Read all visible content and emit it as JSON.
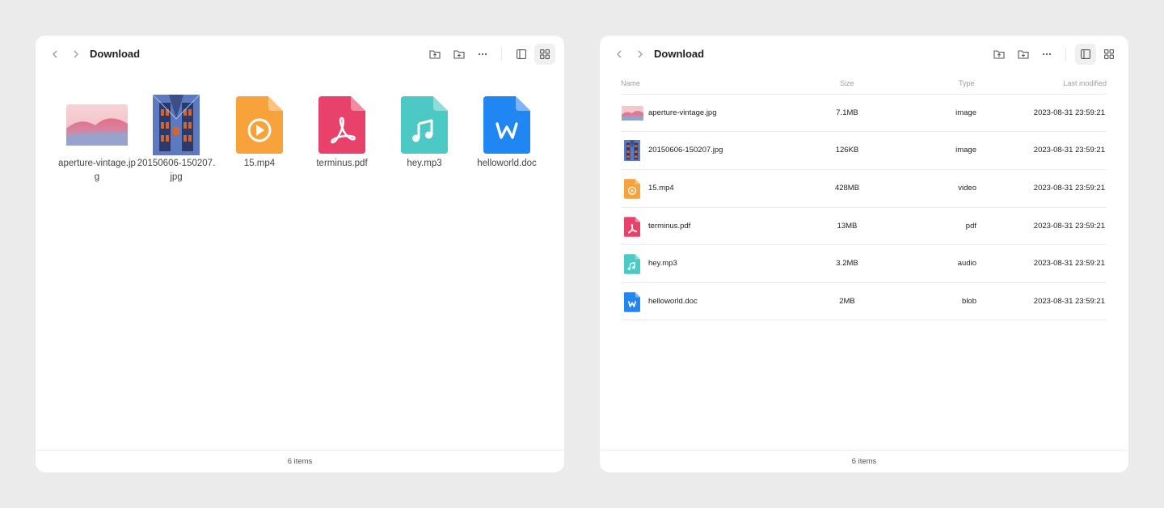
{
  "windows": [
    {
      "view": "grid",
      "title": "Download",
      "footer": "6 items",
      "items": [
        {
          "name": "aperture-vintage.jpg",
          "icon": "landscape-thumbnail"
        },
        {
          "name": "20150606-150207.jpg",
          "icon": "building-thumbnail"
        },
        {
          "name": "15.mp4",
          "icon": "video-file-icon",
          "color": "#f7a23b"
        },
        {
          "name": "terminus.pdf",
          "icon": "pdf-file-icon",
          "color": "#e8426a"
        },
        {
          "name": "hey.mp3",
          "icon": "audio-file-icon",
          "color": "#4cc9c4"
        },
        {
          "name": "helloworld.doc",
          "icon": "word-file-icon",
          "color": "#1f86f2"
        }
      ]
    },
    {
      "view": "list",
      "title": "Download",
      "footer": "6 items",
      "columns": {
        "name": "Name",
        "size": "Size",
        "type": "Type",
        "modified": "Last modified"
      },
      "rows": [
        {
          "name": "aperture-vintage.jpg",
          "size": "7.1MB",
          "type": "image",
          "modified": "2023-08-31 23:59:21",
          "icon": "landscape-thumbnail"
        },
        {
          "name": "20150606-150207.jpg",
          "size": "126KB",
          "type": "image",
          "modified": "2023-08-31 23:59:21",
          "icon": "building-thumbnail"
        },
        {
          "name": "15.mp4",
          "size": "428MB",
          "type": "video",
          "modified": "2023-08-31 23:59:21",
          "icon": "video-file-icon",
          "color": "#f7a23b"
        },
        {
          "name": "terminus.pdf",
          "size": "13MB",
          "type": "pdf",
          "modified": "2023-08-31 23:59:21",
          "icon": "pdf-file-icon",
          "color": "#e8426a"
        },
        {
          "name": "hey.mp3",
          "size": "3.2MB",
          "type": "audio",
          "modified": "2023-08-31 23:59:21",
          "icon": "audio-file-icon",
          "color": "#4cc9c4"
        },
        {
          "name": "helloworld.doc",
          "size": "2MB",
          "type": "blob",
          "modified": "2023-08-31 23:59:21",
          "icon": "word-file-icon",
          "color": "#1f86f2"
        }
      ]
    }
  ],
  "colors": {
    "background": "#ebebeb",
    "window": "#ffffff",
    "active_toggle": "#f0f0f0"
  }
}
